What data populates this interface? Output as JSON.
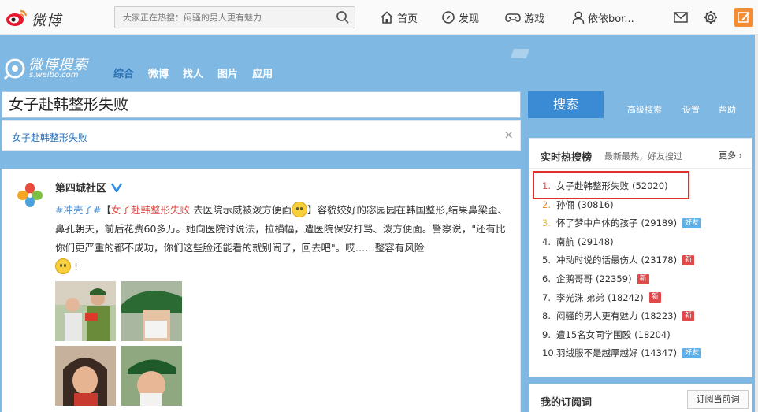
{
  "header": {
    "logo_text": "微博",
    "search_placeholder": "大家正在热搜：闷骚的男人更有魅力",
    "nav": [
      {
        "label": "首页",
        "icon": "home-icon"
      },
      {
        "label": "发现",
        "icon": "compass-icon"
      },
      {
        "label": "游戏",
        "icon": "gamepad-icon"
      },
      {
        "label": "依依bor...",
        "icon": "user-icon"
      }
    ]
  },
  "search": {
    "logo_cn": "微博搜索",
    "logo_en": "s.weibo.com",
    "tabs": [
      "综合",
      "微博",
      "找人",
      "图片",
      "应用"
    ],
    "query": "女子赴韩整形失败",
    "button": "搜索",
    "links": [
      "高级搜索",
      "设置",
      "帮助"
    ],
    "suggestion": "女子赴韩整形失败",
    "close_glyph": "×"
  },
  "post": {
    "author": "第四城社区",
    "tag": "#冲壳子#",
    "bracket_open": "【",
    "highlight": "女子赴韩整形失败",
    "text_1": "去医院示威被泼方便面",
    "bracket_close": "】",
    "text_2": "容貌姣好的宓园园在韩国整形,结果鼻梁歪、鼻孔朝天，前后花费60多万。她向医院讨说法，拉横幅，遭医院保安打骂、泼方便面。警察说，\"还有比你们更严重的都不成功，你们这些脸还能看的就别闹了，回去吧\"。哎……整容有风险",
    "text_end": "!"
  },
  "hot": {
    "title": "实时热搜榜",
    "subtitle": "最新最热，好友搜过",
    "more": "更多",
    "items": [
      {
        "rank": "1.",
        "label": "女子赴韩整形失败",
        "count": "(52020)",
        "badge": ""
      },
      {
        "rank": "2.",
        "label": "孙俪",
        "count": "(30816)",
        "badge": ""
      },
      {
        "rank": "3.",
        "label": "怀了梦中户体的孩子",
        "count": "(29189)",
        "badge": "好友"
      },
      {
        "rank": "4.",
        "label": "南航",
        "count": "(29148)",
        "badge": ""
      },
      {
        "rank": "5.",
        "label": "冲动时说的话最伤人",
        "count": "(23178)",
        "badge": "新"
      },
      {
        "rank": "6.",
        "label": "企鹅哥哥",
        "count": "(22359)",
        "badge": "新"
      },
      {
        "rank": "7.",
        "label": "李光洙 弟弟",
        "count": "(18242)",
        "badge": "新"
      },
      {
        "rank": "8.",
        "label": "闷骚的男人更有魅力",
        "count": "(18223)",
        "badge": "新"
      },
      {
        "rank": "9.",
        "label": "遭15名女同学围殴",
        "count": "(18204)",
        "badge": ""
      },
      {
        "rank": "10.",
        "label": "羽绒服不是越厚越好",
        "count": "(14347)",
        "badge": "好友"
      }
    ]
  },
  "subscription": {
    "title": "我的订阅词",
    "button": "订阅当前词"
  },
  "colors": {
    "brand_orange": "#f48c33",
    "banner_blue": "#7fb9e3",
    "link_blue": "#2a6fb3",
    "highlight_red": "#e24a4a"
  }
}
